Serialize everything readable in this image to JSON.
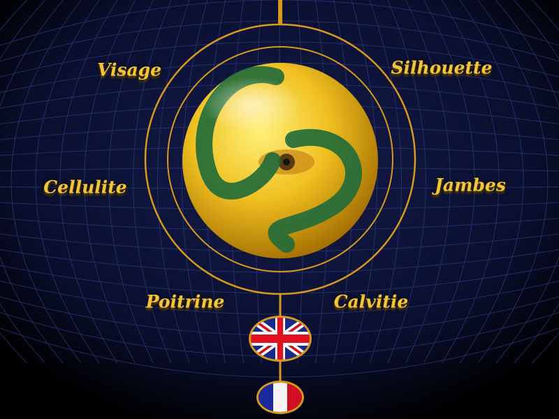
{
  "menu": {
    "items": [
      {
        "id": "visage",
        "label": "Visage"
      },
      {
        "id": "silhouette",
        "label": "Silhouette"
      },
      {
        "id": "cellulite",
        "label": "Cellulite"
      },
      {
        "id": "jambes",
        "label": "Jambes"
      },
      {
        "id": "poitrine",
        "label": "Poitrine"
      },
      {
        "id": "calvitie",
        "label": "Calvitie"
      }
    ]
  },
  "logo": {
    "text": "CS",
    "icon": "eye-logo-icon"
  },
  "languages": [
    {
      "id": "english",
      "icon": "uk-flag-icon"
    },
    {
      "id": "french",
      "icon": "france-flag-icon"
    }
  ],
  "colors": {
    "gold": "#f2c53a",
    "grid": "#1c2a6a",
    "background": "#0a0f2e"
  }
}
